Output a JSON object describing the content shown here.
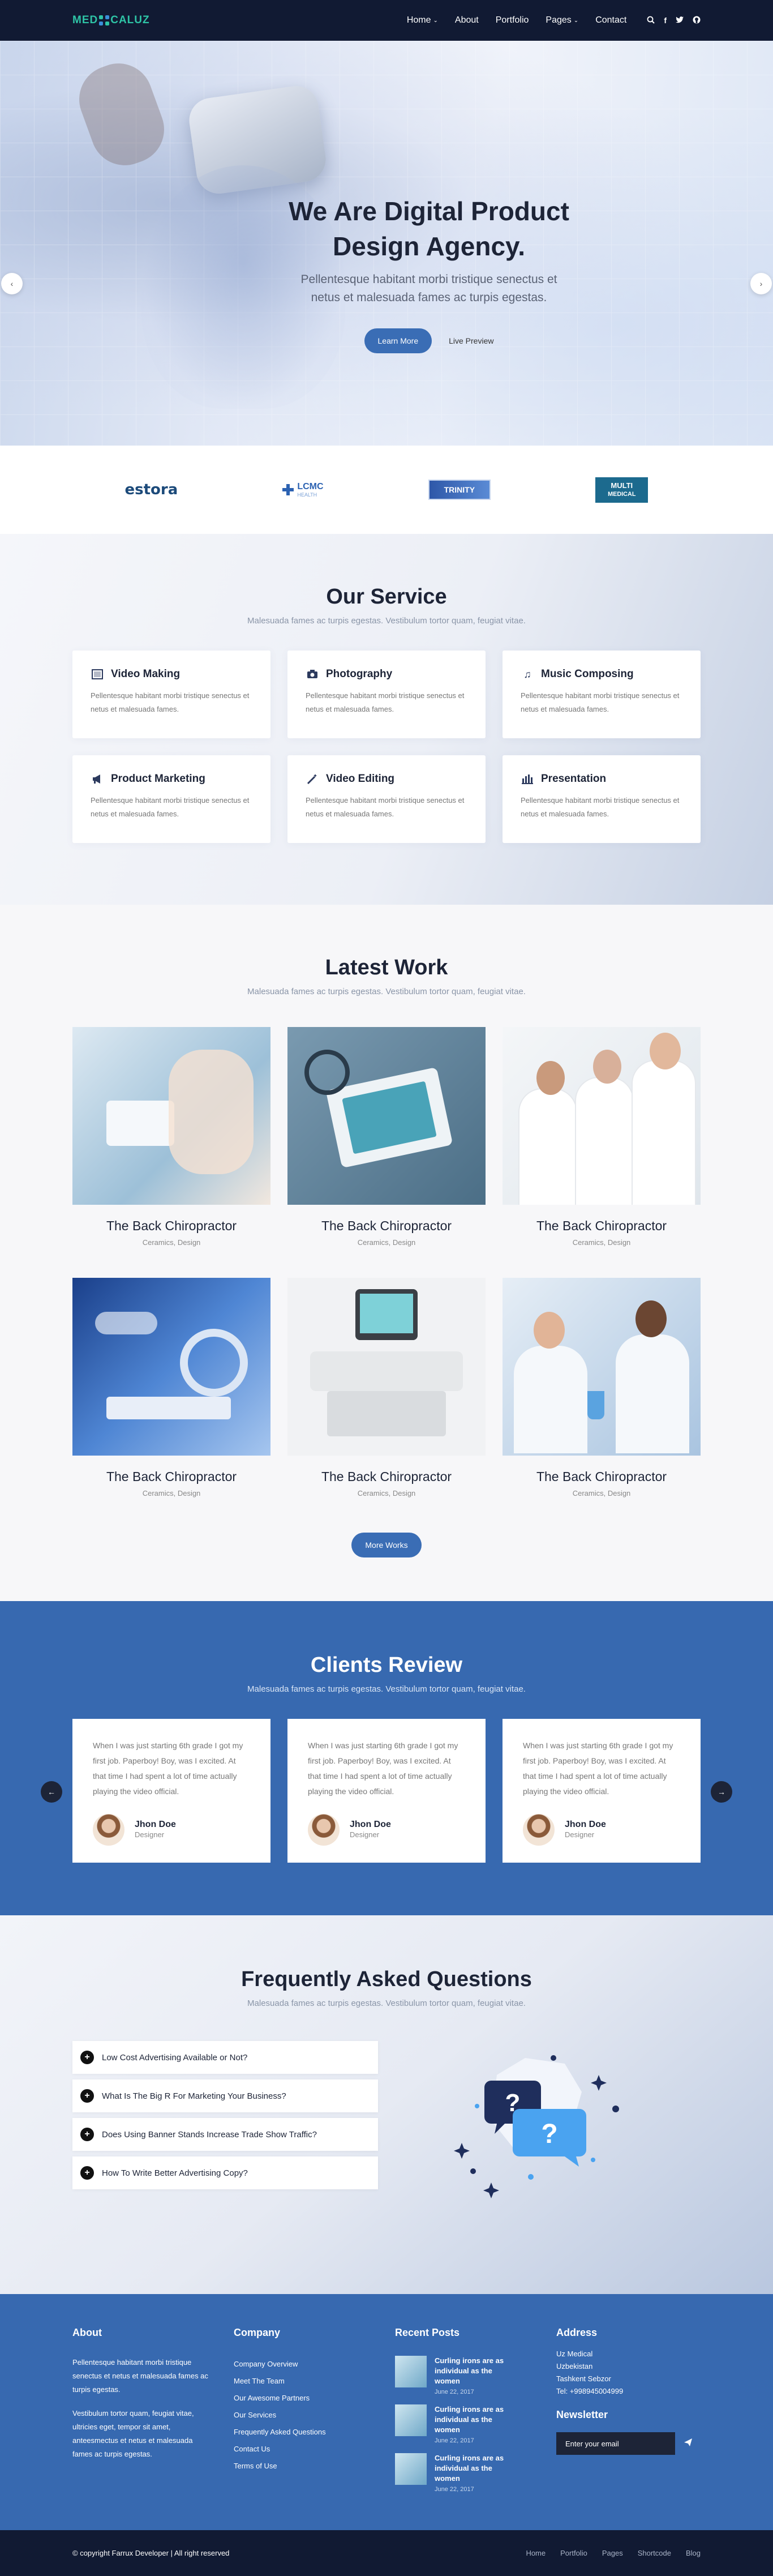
{
  "brand": {
    "logo_left": "MED",
    "logo_right": "CALUZ"
  },
  "nav": {
    "items": [
      {
        "label": "Home",
        "dropdown": true
      },
      {
        "label": "About",
        "dropdown": false
      },
      {
        "label": "Portfolio",
        "dropdown": false
      },
      {
        "label": "Pages",
        "dropdown": true
      },
      {
        "label": "Contact",
        "dropdown": false
      }
    ],
    "icons": [
      "search-icon",
      "facebook-icon",
      "twitter-icon",
      "github-icon"
    ]
  },
  "hero": {
    "title_line1": "We Are Digital Product",
    "title_line2": "Design Agency.",
    "subtitle_line1": "Pellentesque habitant morbi tristique senectus et",
    "subtitle_line2": "netus et malesuada fames ac turpis egestas.",
    "primary": "Learn More",
    "secondary": "Live Preview",
    "slides": 3,
    "active_slide": 2
  },
  "partners": {
    "estora": "estora",
    "lcmc": "LCMC",
    "lcmc_sub": "HEALTH",
    "trinity": "TRINITY",
    "multi_top": "MULTI",
    "multi_bottom": "MEDICAL"
  },
  "service": {
    "title": "Our Service",
    "subtitle": "Malesuada fames ac turpis egestas. Vestibulum tortor quam, feugiat vitae.",
    "items": [
      {
        "icon": "film-icon",
        "title": "Video Making",
        "text": "Pellentesque habitant morbi tristique senectus et netus et malesuada fames."
      },
      {
        "icon": "camera-icon",
        "title": "Photography",
        "text": "Pellentesque habitant morbi tristique senectus et netus et malesuada fames."
      },
      {
        "icon": "music-icon",
        "title": "Music Composing",
        "text": "Pellentesque habitant morbi tristique senectus et netus et malesuada fames."
      },
      {
        "icon": "megaphone-icon",
        "title": "Product Marketing",
        "text": "Pellentesque habitant morbi tristique senectus et netus et malesuada fames."
      },
      {
        "icon": "magic-wand-icon",
        "title": "Video Editing",
        "text": "Pellentesque habitant morbi tristique senectus et netus et malesuada fames."
      },
      {
        "icon": "bar-chart-icon",
        "title": "Presentation",
        "text": "Pellentesque habitant morbi tristique senectus et netus et malesuada fames."
      }
    ]
  },
  "work": {
    "title": "Latest Work",
    "subtitle": "Malesuada fames ac turpis egestas. Vestibulum tortor quam, feugiat vitae.",
    "items": [
      {
        "title": "The Back Chiropractor",
        "category": "Ceramics, Design"
      },
      {
        "title": "The Back Chiropractor",
        "category": "Ceramics, Design"
      },
      {
        "title": "The Back Chiropractor",
        "category": "Ceramics, Design"
      },
      {
        "title": "The Back Chiropractor",
        "category": "Ceramics, Design"
      },
      {
        "title": "The Back Chiropractor",
        "category": "Ceramics, Design"
      },
      {
        "title": "The Back Chiropractor",
        "category": "Ceramics, Design"
      }
    ],
    "more": "More Works"
  },
  "reviews": {
    "title": "Clients Review",
    "subtitle": "Malesuada fames ac turpis egestas. Vestibulum tortor quam, feugiat vitae.",
    "items": [
      {
        "text": "When I was just starting 6th grade I got my first job. Paperboy! Boy, was I excited. At that time I had spent a lot of time actually playing the video official.",
        "name": "Jhon Doe",
        "role": "Designer"
      },
      {
        "text": "When I was just starting 6th grade I got my first job. Paperboy! Boy, was I excited. At that time I had spent a lot of time actually playing the video official.",
        "name": "Jhon Doe",
        "role": "Designer"
      },
      {
        "text": "When I was just starting 6th grade I got my first job. Paperboy! Boy, was I excited. At that time I had spent a lot of time actually playing the video official.",
        "name": "Jhon Doe",
        "role": "Designer"
      }
    ]
  },
  "faq": {
    "title": "Frequently Asked Questions",
    "subtitle": "Malesuada fames ac turpis egestas. Vestibulum tortor quam, feugiat vitae.",
    "items": [
      "Low Cost Advertising Available or Not?",
      "What Is The Big R For Marketing Your Business?",
      "Does Using Banner Stands Increase Trade Show Traffic?",
      "How To Write Better Advertising Copy?"
    ]
  },
  "footer": {
    "about_title": "About",
    "about_p1": "Pellentesque habitant morbi tristique senectus et netus et malesuada fames ac turpis egestas.",
    "about_p2": "Vestibulum tortor quam, feugiat vitae, ultricies eget, tempor sit amet, anteesmectus et netus et malesuada fames ac turpis egestas.",
    "company_title": "Company",
    "company_links": [
      "Company Overview",
      "Meet The Team",
      "Our Awesome Partners",
      "Our Services",
      "Frequently Asked Questions",
      "Contact Us",
      "Terms of Use"
    ],
    "posts_title": "Recent Posts",
    "posts": [
      {
        "title": "Curling irons are as individual as the women",
        "date": "June 22, 2017"
      },
      {
        "title": "Curling irons are as individual as the women",
        "date": "June 22, 2017"
      },
      {
        "title": "Curling irons are as individual as the women",
        "date": "June 22, 2017"
      }
    ],
    "address_title": "Address",
    "address_lines": [
      "Uz Medical",
      "Uzbekistan",
      "Tashkent Sebzor",
      "Tel: +998945004999"
    ],
    "newsletter_title": "Newsletter",
    "newsletter_placeholder": "Enter your email"
  },
  "bottom": {
    "copyright": "© copyright Farrux Developer | All right reserved",
    "links": [
      "Home",
      "Portfolio",
      "Pages",
      "Shortcode",
      "Blog"
    ]
  }
}
